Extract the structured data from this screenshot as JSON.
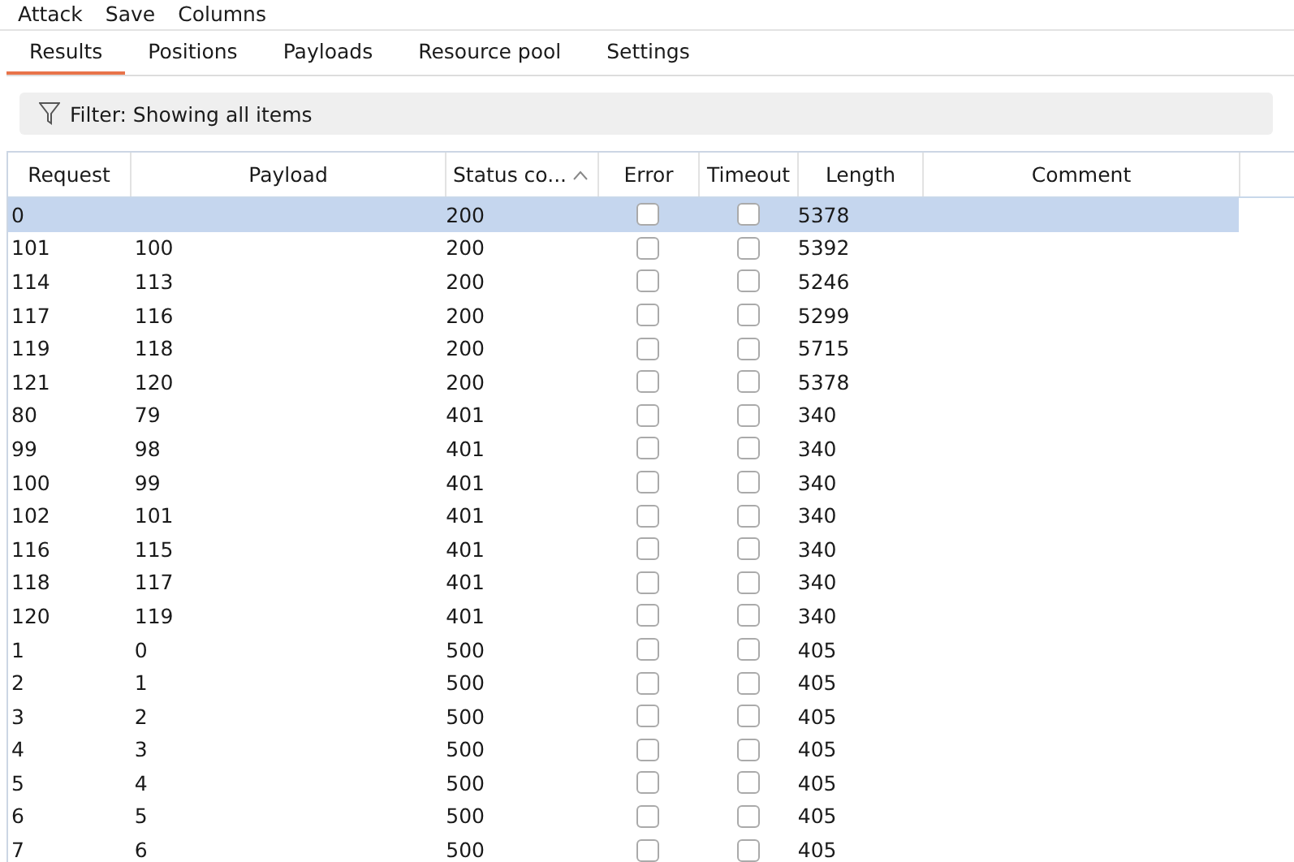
{
  "menu": [
    "Attack",
    "Save",
    "Columns"
  ],
  "tabs": [
    {
      "label": "Results",
      "selected": true
    },
    {
      "label": "Positions",
      "selected": false
    },
    {
      "label": "Payloads",
      "selected": false
    },
    {
      "label": "Resource pool",
      "selected": false
    },
    {
      "label": "Settings",
      "selected": false
    }
  ],
  "filter": {
    "label": "Filter: Showing all items"
  },
  "table": {
    "columns": [
      {
        "label": "Request",
        "sorted": false
      },
      {
        "label": "Payload",
        "sorted": false
      },
      {
        "label": "Status co...",
        "sorted": true
      },
      {
        "label": "Error",
        "sorted": false
      },
      {
        "label": "Timeout",
        "sorted": false
      },
      {
        "label": "Length",
        "sorted": false
      },
      {
        "label": "Comment",
        "sorted": false
      }
    ],
    "rows": [
      {
        "request": "0",
        "payload": "",
        "status": "200",
        "error": false,
        "timeout": false,
        "length": "5378",
        "selected": true
      },
      {
        "request": "101",
        "payload": "100",
        "status": "200",
        "error": false,
        "timeout": false,
        "length": "5392",
        "selected": false
      },
      {
        "request": "114",
        "payload": "113",
        "status": "200",
        "error": false,
        "timeout": false,
        "length": "5246",
        "selected": false
      },
      {
        "request": "117",
        "payload": "116",
        "status": "200",
        "error": false,
        "timeout": false,
        "length": "5299",
        "selected": false
      },
      {
        "request": "119",
        "payload": "118",
        "status": "200",
        "error": false,
        "timeout": false,
        "length": "5715",
        "selected": false
      },
      {
        "request": "121",
        "payload": "120",
        "status": "200",
        "error": false,
        "timeout": false,
        "length": "5378",
        "selected": false
      },
      {
        "request": "80",
        "payload": "79",
        "status": "401",
        "error": false,
        "timeout": false,
        "length": "340",
        "selected": false
      },
      {
        "request": "99",
        "payload": "98",
        "status": "401",
        "error": false,
        "timeout": false,
        "length": "340",
        "selected": false
      },
      {
        "request": "100",
        "payload": "99",
        "status": "401",
        "error": false,
        "timeout": false,
        "length": "340",
        "selected": false
      },
      {
        "request": "102",
        "payload": "101",
        "status": "401",
        "error": false,
        "timeout": false,
        "length": "340",
        "selected": false
      },
      {
        "request": "116",
        "payload": "115",
        "status": "401",
        "error": false,
        "timeout": false,
        "length": "340",
        "selected": false
      },
      {
        "request": "118",
        "payload": "117",
        "status": "401",
        "error": false,
        "timeout": false,
        "length": "340",
        "selected": false
      },
      {
        "request": "120",
        "payload": "119",
        "status": "401",
        "error": false,
        "timeout": false,
        "length": "340",
        "selected": false
      },
      {
        "request": "1",
        "payload": "0",
        "status": "500",
        "error": false,
        "timeout": false,
        "length": "405",
        "selected": false
      },
      {
        "request": "2",
        "payload": "1",
        "status": "500",
        "error": false,
        "timeout": false,
        "length": "405",
        "selected": false
      },
      {
        "request": "3",
        "payload": "2",
        "status": "500",
        "error": false,
        "timeout": false,
        "length": "405",
        "selected": false
      },
      {
        "request": "4",
        "payload": "3",
        "status": "500",
        "error": false,
        "timeout": false,
        "length": "405",
        "selected": false
      },
      {
        "request": "5",
        "payload": "4",
        "status": "500",
        "error": false,
        "timeout": false,
        "length": "405",
        "selected": false
      },
      {
        "request": "6",
        "payload": "5",
        "status": "500",
        "error": false,
        "timeout": false,
        "length": "405",
        "selected": false
      },
      {
        "request": "7",
        "payload": "6",
        "status": "500",
        "error": false,
        "timeout": false,
        "length": "405",
        "selected": false
      }
    ]
  }
}
